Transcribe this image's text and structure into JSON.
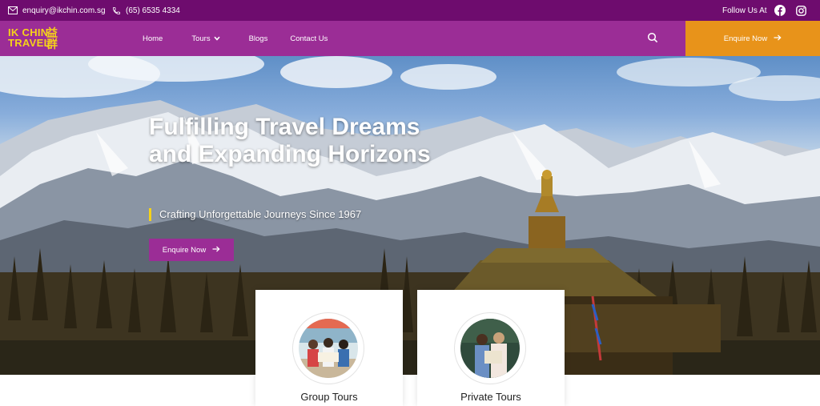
{
  "topbar": {
    "email": "enquiry@ikchin.com.sg",
    "phone": "(65) 6535 4334",
    "follow_label": "Follow Us At",
    "social_icons": [
      "facebook-icon",
      "instagram-icon"
    ]
  },
  "nav": {
    "logo_line1": "IK CHIN",
    "logo_line2": "TRAVEL",
    "logo_glyph_top": "益",
    "logo_glyph_bottom": "群",
    "items": [
      {
        "label": "Home"
      },
      {
        "label": "Tours"
      },
      {
        "label": "Blogs"
      },
      {
        "label": "Contact Us"
      }
    ],
    "cta_label": "Enquire Now"
  },
  "hero": {
    "title": "Fulfilling Travel Dreams and Expanding Horizons",
    "subtitle": "Crafting Unforgettable Journeys Since 1967",
    "cta_label": "Enquire Now"
  },
  "cards": [
    {
      "title": "Group Tours"
    },
    {
      "title": "Private Tours"
    }
  ],
  "colors": {
    "topbar": "#6e0c6e",
    "nav": "#9b2d96",
    "accent_orange": "#e8931a",
    "logo_yellow": "#f5d21a"
  }
}
